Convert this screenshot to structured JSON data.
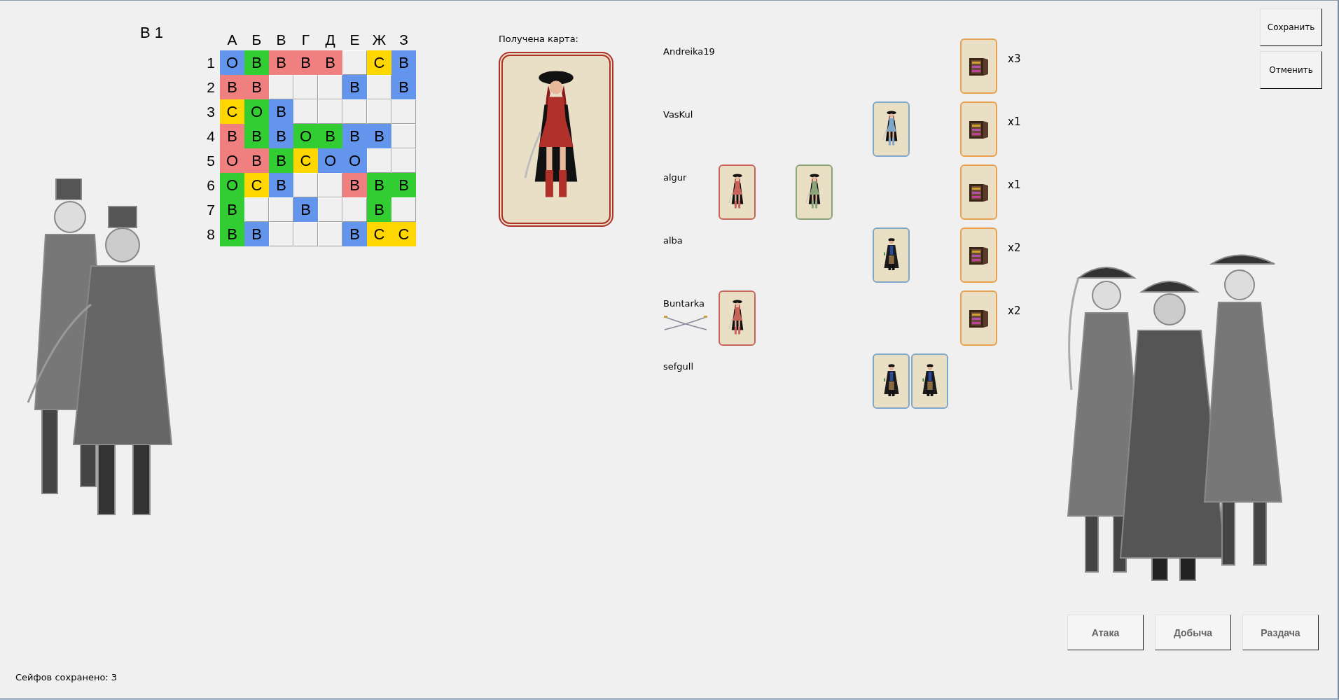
{
  "title": "В 1",
  "grid": {
    "columns": [
      "А",
      "Б",
      "В",
      "Г",
      "Д",
      "Е",
      "Ж",
      "З"
    ],
    "rows": [
      {
        "label": "1",
        "cells": [
          {
            "kind": "filled",
            "letter": "О",
            "color": "#6495ed"
          },
          {
            "kind": "filled",
            "letter": "В",
            "color": "#32cd32"
          },
          {
            "kind": "filled",
            "letter": "В",
            "color": "#f08080"
          },
          {
            "kind": "filled",
            "letter": "В",
            "color": "#f08080"
          },
          {
            "kind": "filled",
            "letter": "В",
            "color": "#f08080"
          },
          {
            "kind": "empty"
          },
          {
            "kind": "filled",
            "letter": "С",
            "color": "#ffd700"
          },
          {
            "kind": "filled",
            "letter": "В",
            "color": "#6495ed"
          }
        ]
      },
      {
        "label": "2",
        "cells": [
          {
            "kind": "filled",
            "letter": "В",
            "color": "#f08080"
          },
          {
            "kind": "filled",
            "letter": "В",
            "color": "#f08080"
          },
          {
            "kind": "empty"
          },
          {
            "kind": "empty"
          },
          {
            "kind": "empty"
          },
          {
            "kind": "filled",
            "letter": "В",
            "color": "#6495ed"
          },
          {
            "kind": "empty"
          },
          {
            "kind": "filled",
            "letter": "В",
            "color": "#6495ed"
          }
        ]
      },
      {
        "label": "3",
        "cells": [
          {
            "kind": "filled",
            "letter": "С",
            "color": "#ffd700"
          },
          {
            "kind": "filled",
            "letter": "О",
            "color": "#32cd32"
          },
          {
            "kind": "filled",
            "letter": "В",
            "color": "#6495ed"
          },
          {
            "kind": "empty"
          },
          {
            "kind": "empty"
          },
          {
            "kind": "empty"
          },
          {
            "kind": "empty"
          },
          {
            "kind": "empty"
          }
        ]
      },
      {
        "label": "4",
        "cells": [
          {
            "kind": "filled",
            "letter": "В",
            "color": "#f08080"
          },
          {
            "kind": "filled",
            "letter": "В",
            "color": "#32cd32"
          },
          {
            "kind": "filled",
            "letter": "В",
            "color": "#6495ed"
          },
          {
            "kind": "filled",
            "letter": "О",
            "color": "#32cd32"
          },
          {
            "kind": "filled",
            "letter": "В",
            "color": "#32cd32"
          },
          {
            "kind": "filled",
            "letter": "В",
            "color": "#6495ed"
          },
          {
            "kind": "filled",
            "letter": "В",
            "color": "#6495ed"
          },
          {
            "kind": "empty"
          }
        ]
      },
      {
        "label": "5",
        "cells": [
          {
            "kind": "filled",
            "letter": "О",
            "color": "#f08080"
          },
          {
            "kind": "filled",
            "letter": "В",
            "color": "#f08080"
          },
          {
            "kind": "filled",
            "letter": "В",
            "color": "#32cd32"
          },
          {
            "kind": "filled",
            "letter": "С",
            "color": "#ffd700"
          },
          {
            "kind": "filled",
            "letter": "О",
            "color": "#6495ed"
          },
          {
            "kind": "filled",
            "letter": "О",
            "color": "#6495ed"
          },
          {
            "kind": "empty"
          },
          {
            "kind": "empty"
          }
        ]
      },
      {
        "label": "6",
        "cells": [
          {
            "kind": "filled",
            "letter": "О",
            "color": "#32cd32"
          },
          {
            "kind": "filled",
            "letter": "С",
            "color": "#ffd700"
          },
          {
            "kind": "filled",
            "letter": "В",
            "color": "#6495ed"
          },
          {
            "kind": "empty"
          },
          {
            "kind": "empty"
          },
          {
            "kind": "filled",
            "letter": "В",
            "color": "#f08080"
          },
          {
            "kind": "filled",
            "letter": "В",
            "color": "#32cd32"
          },
          {
            "kind": "filled",
            "letter": "В",
            "color": "#32cd32"
          }
        ]
      },
      {
        "label": "7",
        "cells": [
          {
            "kind": "filled",
            "letter": "В",
            "color": "#32cd32"
          },
          {
            "kind": "empty"
          },
          {
            "kind": "empty"
          },
          {
            "kind": "filled",
            "letter": "В",
            "color": "#6495ed"
          },
          {
            "kind": "empty"
          },
          {
            "kind": "empty"
          },
          {
            "kind": "filled",
            "letter": "В",
            "color": "#32cd32"
          },
          {
            "kind": "empty"
          }
        ]
      },
      {
        "label": "8",
        "cells": [
          {
            "kind": "filled",
            "letter": "В",
            "color": "#32cd32"
          },
          {
            "kind": "filled",
            "letter": "В",
            "color": "#6495ed"
          },
          {
            "kind": "empty"
          },
          {
            "kind": "empty"
          },
          {
            "kind": "empty"
          },
          {
            "kind": "filled",
            "letter": "В",
            "color": "#6495ed"
          },
          {
            "kind": "filled",
            "letter": "С",
            "color": "#ffd700"
          },
          {
            "kind": "filled",
            "letter": "С",
            "color": "#ffd700"
          }
        ]
      }
    ]
  },
  "received_card": {
    "label": "Получена карта:",
    "kind": "woman",
    "color": "#b0302a"
  },
  "players": [
    {
      "name": "Andreika19",
      "attacking": false,
      "slots": [
        {
          "kind": "empty"
        },
        {
          "kind": "empty"
        },
        {
          "kind": "empty"
        }
      ],
      "safe": {
        "count": "x3"
      }
    },
    {
      "name": "VasKul",
      "attacking": false,
      "slots": [
        {
          "kind": "empty"
        },
        {
          "kind": "empty"
        },
        {
          "kind": "cards",
          "cards": [
            {
              "kind": "woman",
              "color": "#7fa7c8"
            }
          ]
        }
      ],
      "safe": {
        "count": "x1"
      }
    },
    {
      "name": "algur",
      "attacking": false,
      "slots": [
        {
          "kind": "cards",
          "cards": [
            {
              "kind": "woman",
              "color": "#c8645a"
            }
          ]
        },
        {
          "kind": "cards",
          "cards": [
            {
              "kind": "woman",
              "color": "#8aa57a"
            }
          ]
        },
        {
          "kind": "empty"
        }
      ],
      "safe": {
        "count": "x1"
      }
    },
    {
      "name": "alba",
      "attacking": false,
      "slots": [
        {
          "kind": "empty"
        },
        {
          "kind": "empty"
        },
        {
          "kind": "cards",
          "cards": [
            {
              "kind": "man",
              "color": "#7fa7c8"
            }
          ]
        }
      ],
      "safe": {
        "count": "x2"
      }
    },
    {
      "name": "Buntarka",
      "attacking": true,
      "slots": [
        {
          "kind": "cards",
          "cards": [
            {
              "kind": "woman",
              "color": "#c8645a"
            }
          ]
        },
        {
          "kind": "empty"
        },
        {
          "kind": "empty"
        }
      ],
      "safe": {
        "count": "x2"
      }
    },
    {
      "name": "sefgull",
      "attacking": false,
      "slots": [
        {
          "kind": "empty"
        },
        {
          "kind": "empty"
        },
        {
          "kind": "cards",
          "cards": [
            {
              "kind": "man",
              "color": "#7fa7c8"
            },
            {
              "kind": "man",
              "color": "#7fa7c8"
            }
          ]
        }
      ]
    }
  ],
  "top_buttons": [
    {
      "label": "Сохранить"
    },
    {
      "label": "Отменить"
    }
  ],
  "action_buttons": [
    {
      "label": "Атака"
    },
    {
      "label": "Добыча"
    },
    {
      "label": "Раздача"
    }
  ],
  "status": "Сейфов сохранено: 3"
}
